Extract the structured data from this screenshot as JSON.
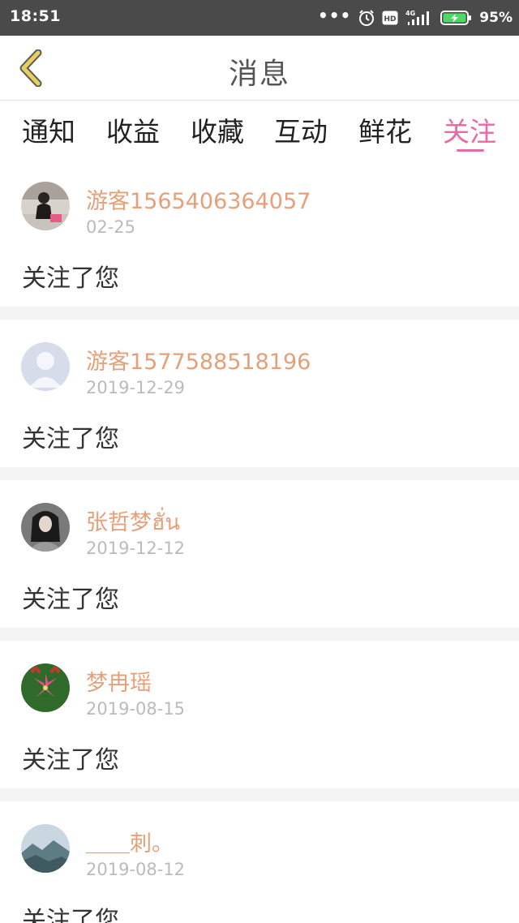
{
  "status_bar": {
    "time": "18:51",
    "dots": "•••",
    "alarm_icon": "alarm-icon",
    "hd_icon": "hd-icon",
    "signal_icon": "signal-4g-icon",
    "battery_icon": "battery-charging-icon",
    "battery_percent": "95%"
  },
  "header": {
    "back_icon": "chevron-left-icon",
    "title": "消息"
  },
  "tabs": {
    "items": [
      {
        "label": "通知"
      },
      {
        "label": "收益"
      },
      {
        "label": "收藏"
      },
      {
        "label": "互动"
      },
      {
        "label": "鲜花"
      },
      {
        "label": "关注"
      }
    ],
    "active_index": 5,
    "active_color": "#e86aa6"
  },
  "feed": {
    "items": [
      {
        "username": "游客1565406364057",
        "date": "02-25",
        "message": "关注了您"
      },
      {
        "username": "游客1577588518196",
        "date": "2019-12-29",
        "message": "关注了您"
      },
      {
        "username": "张哲梦ฮั่น",
        "date": "2019-12-12",
        "message": "关注了您"
      },
      {
        "username": "梦冉瑶",
        "date": "2019-08-15",
        "message": "关注了您"
      },
      {
        "username": "＿＿刺。",
        "date": "2019-08-12",
        "message": "关注了您"
      }
    ]
  },
  "colors": {
    "status_bar_bg": "#4a4a4a",
    "username": "#e5a07a",
    "date": "#bbbbbb",
    "separator": "#f3f3f3",
    "back_arrow": "#d6b84a"
  }
}
